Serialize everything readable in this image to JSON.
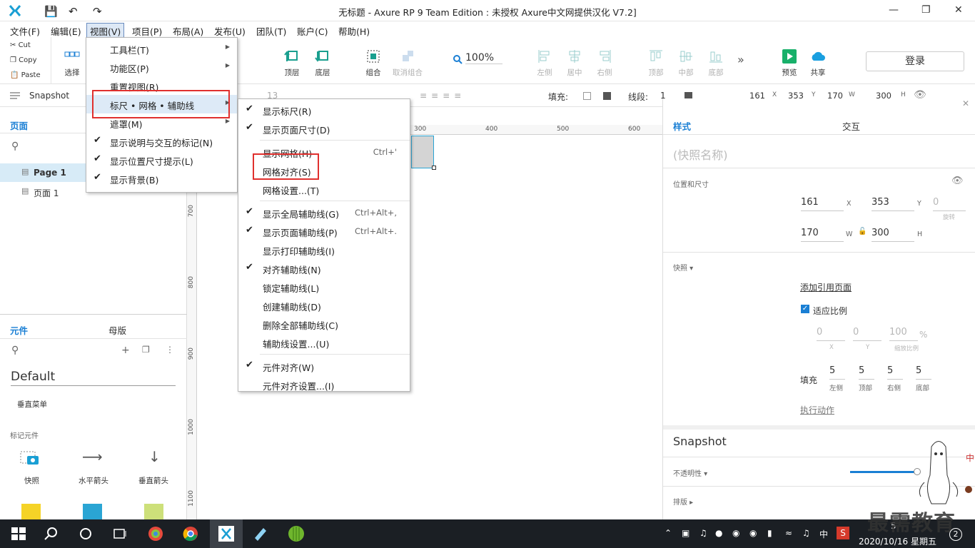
{
  "window": {
    "title": "无标题 - Axure RP 9 Team Edition : 未授权    Axure中文网提供汉化 V7.2]"
  },
  "menubar": [
    "文件(F)",
    "编辑(E)",
    "视图(V)",
    "项目(P)",
    "布局(A)",
    "发布(U)",
    "团队(T)",
    "账户(C)",
    "帮助(H)"
  ],
  "clipboard": {
    "cut": "Cut",
    "copy": "Copy",
    "paste": "Paste"
  },
  "toolbar": {
    "select": "选择",
    "top": "顶层",
    "bottom": "底层",
    "group": "组合",
    "ungroup": "取消组合",
    "zoom": "100%",
    "left": "左侧",
    "center": "居中",
    "right": "右侧",
    "vtop": "顶部",
    "middle": "中部",
    "vbottom": "底部",
    "preview": "预览",
    "share": "共享",
    "login": "登录"
  },
  "stylebar": {
    "font_size": "13",
    "fill_label": "填充:",
    "line_label": "线段:",
    "line_width": "1",
    "x": "161",
    "x_l": "X",
    "y": "353",
    "y_l": "Y",
    "w": "170",
    "w_l": "W",
    "h": "300",
    "h_l": "H"
  },
  "left": {
    "snapshot": "Snapshot",
    "pages_tab": "页面",
    "pages": [
      "Page 1",
      "页面 1"
    ],
    "widgets_tab": "元件",
    "masters_tab": "母版",
    "library": "Default",
    "vmenu": "垂直菜单",
    "markers_group": "标记元件",
    "markers": [
      "快照",
      "水平箭头",
      "垂直箭头"
    ]
  },
  "ruler": {
    "top": [
      "300",
      "400",
      "500",
      "600"
    ],
    "left": [
      "700",
      "800",
      "900",
      "1000",
      "1100"
    ]
  },
  "view_menu": [
    {
      "label": "工具栏(T)",
      "arrow": true
    },
    {
      "label": "功能区(P)",
      "arrow": true
    },
    {
      "label": "重置视图(R)"
    },
    {
      "label": "标尺 • 网格 • 辅助线",
      "arrow": true,
      "hl": true
    },
    {
      "label": "遮罩(M)",
      "arrow": true
    },
    {
      "label": "显示说明与交互的标记(N)",
      "check": true
    },
    {
      "label": "显示位置尺寸提示(L)",
      "check": true
    },
    {
      "label": "显示背景(B)",
      "check": true
    }
  ],
  "sub_menu": [
    {
      "label": "显示标尺(R)",
      "check": true
    },
    {
      "label": "显示页面尺寸(D)",
      "check": true
    },
    {
      "label": "显示网格(H)",
      "sc": "Ctrl+'"
    },
    {
      "label": "网格对齐(S)"
    },
    {
      "label": "网格设置...(T)"
    },
    {
      "label": "显示全局辅助线(G)",
      "check": true,
      "sc": "Ctrl+Alt+,"
    },
    {
      "label": "显示页面辅助线(P)",
      "check": true,
      "sc": "Ctrl+Alt+."
    },
    {
      "label": "显示打印辅助线(I)"
    },
    {
      "label": "对齐辅助线(N)",
      "check": true
    },
    {
      "label": "锁定辅助线(L)"
    },
    {
      "label": "创建辅助线(D)"
    },
    {
      "label": "删除全部辅助线(C)"
    },
    {
      "label": "辅助线设置...(U)"
    },
    {
      "label": "元件对齐(W)",
      "check": true
    },
    {
      "label": "元件对齐设置...(I)"
    }
  ],
  "right": {
    "style_tab": "样式",
    "interact_tab": "交互",
    "name_ph": "(快照名称)",
    "pos_title": "位置和尺寸",
    "x": "161",
    "y": "353",
    "rot": "0",
    "rot_l": "旋转",
    "w": "170",
    "h": "300",
    "snap_title": "快照",
    "add_ref": "添加引用页面",
    "fit": "适应比例",
    "sx": "0",
    "sy": "0",
    "scale": "100",
    "pct": "%",
    "scale_l": "缩放比例",
    "fill": "填充",
    "pad": [
      "5",
      "5",
      "5",
      "5"
    ],
    "pad_l": [
      "左侧",
      "顶部",
      "右侧",
      "底部"
    ],
    "action": "执行动作",
    "widget_name": "Snapshot",
    "opacity": "不透明性",
    "layout": "排版",
    "opacity_pct": 1.0
  },
  "taskbar": {
    "ime": "中",
    "date": "2020/10/16 星期五",
    "time": "5",
    "badge": "2",
    "watermark": "最需教育"
  }
}
